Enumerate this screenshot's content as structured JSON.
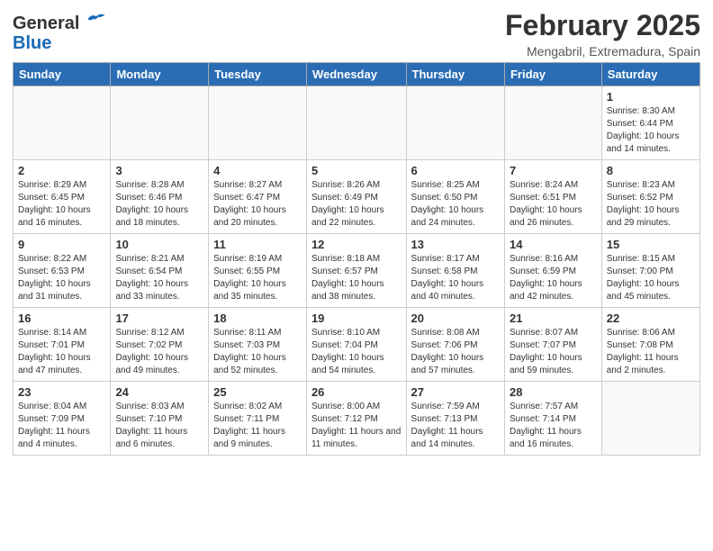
{
  "header": {
    "logo_general": "General",
    "logo_blue": "Blue",
    "month_title": "February 2025",
    "location": "Mengabril, Extremadura, Spain"
  },
  "weekdays": [
    "Sunday",
    "Monday",
    "Tuesday",
    "Wednesday",
    "Thursday",
    "Friday",
    "Saturday"
  ],
  "weeks": [
    [
      {
        "day": "",
        "info": ""
      },
      {
        "day": "",
        "info": ""
      },
      {
        "day": "",
        "info": ""
      },
      {
        "day": "",
        "info": ""
      },
      {
        "day": "",
        "info": ""
      },
      {
        "day": "",
        "info": ""
      },
      {
        "day": "1",
        "info": "Sunrise: 8:30 AM\nSunset: 6:44 PM\nDaylight: 10 hours and 14 minutes."
      }
    ],
    [
      {
        "day": "2",
        "info": "Sunrise: 8:29 AM\nSunset: 6:45 PM\nDaylight: 10 hours and 16 minutes."
      },
      {
        "day": "3",
        "info": "Sunrise: 8:28 AM\nSunset: 6:46 PM\nDaylight: 10 hours and 18 minutes."
      },
      {
        "day": "4",
        "info": "Sunrise: 8:27 AM\nSunset: 6:47 PM\nDaylight: 10 hours and 20 minutes."
      },
      {
        "day": "5",
        "info": "Sunrise: 8:26 AM\nSunset: 6:49 PM\nDaylight: 10 hours and 22 minutes."
      },
      {
        "day": "6",
        "info": "Sunrise: 8:25 AM\nSunset: 6:50 PM\nDaylight: 10 hours and 24 minutes."
      },
      {
        "day": "7",
        "info": "Sunrise: 8:24 AM\nSunset: 6:51 PM\nDaylight: 10 hours and 26 minutes."
      },
      {
        "day": "8",
        "info": "Sunrise: 8:23 AM\nSunset: 6:52 PM\nDaylight: 10 hours and 29 minutes."
      }
    ],
    [
      {
        "day": "9",
        "info": "Sunrise: 8:22 AM\nSunset: 6:53 PM\nDaylight: 10 hours and 31 minutes."
      },
      {
        "day": "10",
        "info": "Sunrise: 8:21 AM\nSunset: 6:54 PM\nDaylight: 10 hours and 33 minutes."
      },
      {
        "day": "11",
        "info": "Sunrise: 8:19 AM\nSunset: 6:55 PM\nDaylight: 10 hours and 35 minutes."
      },
      {
        "day": "12",
        "info": "Sunrise: 8:18 AM\nSunset: 6:57 PM\nDaylight: 10 hours and 38 minutes."
      },
      {
        "day": "13",
        "info": "Sunrise: 8:17 AM\nSunset: 6:58 PM\nDaylight: 10 hours and 40 minutes."
      },
      {
        "day": "14",
        "info": "Sunrise: 8:16 AM\nSunset: 6:59 PM\nDaylight: 10 hours and 42 minutes."
      },
      {
        "day": "15",
        "info": "Sunrise: 8:15 AM\nSunset: 7:00 PM\nDaylight: 10 hours and 45 minutes."
      }
    ],
    [
      {
        "day": "16",
        "info": "Sunrise: 8:14 AM\nSunset: 7:01 PM\nDaylight: 10 hours and 47 minutes."
      },
      {
        "day": "17",
        "info": "Sunrise: 8:12 AM\nSunset: 7:02 PM\nDaylight: 10 hours and 49 minutes."
      },
      {
        "day": "18",
        "info": "Sunrise: 8:11 AM\nSunset: 7:03 PM\nDaylight: 10 hours and 52 minutes."
      },
      {
        "day": "19",
        "info": "Sunrise: 8:10 AM\nSunset: 7:04 PM\nDaylight: 10 hours and 54 minutes."
      },
      {
        "day": "20",
        "info": "Sunrise: 8:08 AM\nSunset: 7:06 PM\nDaylight: 10 hours and 57 minutes."
      },
      {
        "day": "21",
        "info": "Sunrise: 8:07 AM\nSunset: 7:07 PM\nDaylight: 10 hours and 59 minutes."
      },
      {
        "day": "22",
        "info": "Sunrise: 8:06 AM\nSunset: 7:08 PM\nDaylight: 11 hours and 2 minutes."
      }
    ],
    [
      {
        "day": "23",
        "info": "Sunrise: 8:04 AM\nSunset: 7:09 PM\nDaylight: 11 hours and 4 minutes."
      },
      {
        "day": "24",
        "info": "Sunrise: 8:03 AM\nSunset: 7:10 PM\nDaylight: 11 hours and 6 minutes."
      },
      {
        "day": "25",
        "info": "Sunrise: 8:02 AM\nSunset: 7:11 PM\nDaylight: 11 hours and 9 minutes."
      },
      {
        "day": "26",
        "info": "Sunrise: 8:00 AM\nSunset: 7:12 PM\nDaylight: 11 hours and 11 minutes."
      },
      {
        "day": "27",
        "info": "Sunrise: 7:59 AM\nSunset: 7:13 PM\nDaylight: 11 hours and 14 minutes."
      },
      {
        "day": "28",
        "info": "Sunrise: 7:57 AM\nSunset: 7:14 PM\nDaylight: 11 hours and 16 minutes."
      },
      {
        "day": "",
        "info": ""
      }
    ]
  ]
}
